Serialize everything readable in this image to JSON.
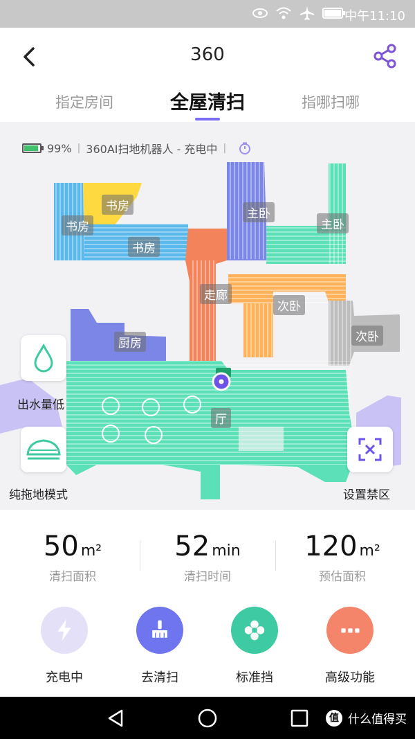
{
  "status_bar": {
    "time": "中午11:10",
    "icons": [
      "eye-icon",
      "wifi-icon",
      "airplane-icon",
      "battery-icon"
    ]
  },
  "header": {
    "title": "360",
    "back_icon": "chevron-left-icon",
    "share_icon": "share-icon"
  },
  "tabs": [
    {
      "label": "指定房间",
      "active": false
    },
    {
      "label": "全屋清扫",
      "active": true
    },
    {
      "label": "指哪扫哪",
      "active": false
    }
  ],
  "device_status": {
    "battery": "99%",
    "device": "360AI扫地机器人 - 充电中"
  },
  "rooms": [
    {
      "label": "书房"
    },
    {
      "label": "书房"
    },
    {
      "label": "书房"
    },
    {
      "label": "主卧"
    },
    {
      "label": "主卧"
    },
    {
      "label": "走廊"
    },
    {
      "label": "次卧"
    },
    {
      "label": "次卧"
    },
    {
      "label": "厨房"
    },
    {
      "label": "厅"
    }
  ],
  "side_controls": {
    "water": {
      "label": "出水量低",
      "icon": "water-drop-icon"
    },
    "mop": {
      "label": "纯拖地模式",
      "icon": "mop-icon"
    },
    "no_go": {
      "label": "设置禁区",
      "icon": "no-go-zone-icon"
    }
  },
  "stats": [
    {
      "value": "50",
      "unit": "m²",
      "label": "清扫面积"
    },
    {
      "value": "52",
      "unit": "min",
      "label": "清扫时间"
    },
    {
      "value": "120",
      "unit": "m²",
      "label": "预估面积"
    }
  ],
  "actions": [
    {
      "label": "充电中",
      "icon": "lightning-icon",
      "color": "#e3e0f7"
    },
    {
      "label": "去清扫",
      "icon": "broom-icon",
      "color": "#6f74ef"
    },
    {
      "label": "标准挡",
      "icon": "fan-icon",
      "color": "#3ecaa2"
    },
    {
      "label": "高级功能",
      "icon": "more-icon",
      "color": "#f4846a"
    }
  ],
  "colors": {
    "accent": "#7b6cf6",
    "map_green": "#5ce0b8",
    "map_blue": "#7b86e6",
    "map_orange": "#ffb25a",
    "map_red": "#f3835b",
    "map_yellow": "#ffd940",
    "map_lightblue": "#5ab8ea",
    "map_gray": "#bdbdbd",
    "map_lavender": "#c9c2f5"
  },
  "watermark": {
    "logo": "值",
    "text": "什么值得买"
  }
}
